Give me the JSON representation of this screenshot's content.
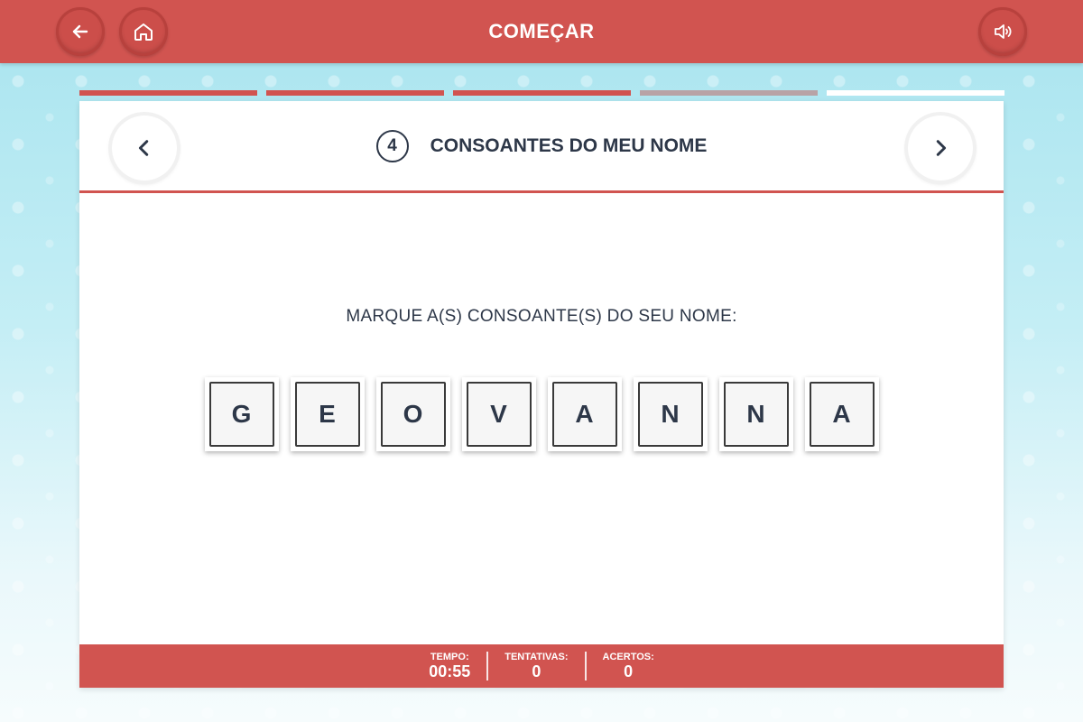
{
  "header": {
    "title": "COMEÇAR",
    "back_icon": "arrow-left-icon",
    "home_icon": "home-icon",
    "sound_icon": "speaker-icon",
    "accent_color": "#d15450"
  },
  "progress": {
    "segments": [
      "done",
      "done",
      "done",
      "partial",
      "empty"
    ]
  },
  "activity": {
    "step_number": "4",
    "title": "CONSOANTES DO MEU NOME",
    "instruction": "MARQUE A(S) CONSOANTE(S) DO SEU NOME:",
    "letters": [
      "G",
      "E",
      "O",
      "V",
      "A",
      "N",
      "N",
      "A"
    ]
  },
  "stats": {
    "time_label": "TEMPO:",
    "time_value": "00:55",
    "attempts_label": "TENTATIVAS:",
    "attempts_value": "0",
    "hits_label": "ACERTOS:",
    "hits_value": "0"
  }
}
